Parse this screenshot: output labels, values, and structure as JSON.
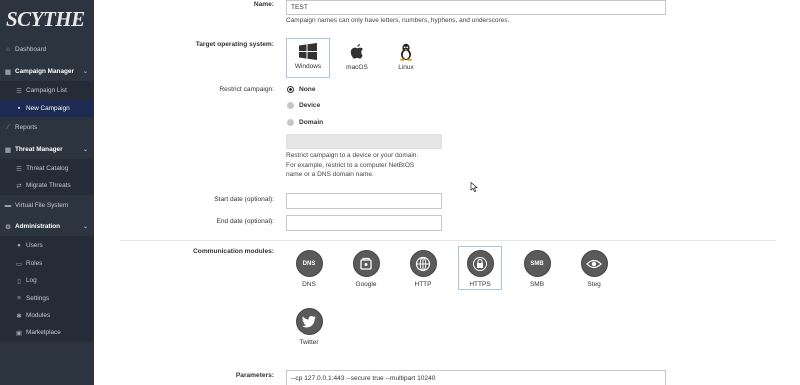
{
  "brand": {
    "logo_text": "SCYTHE"
  },
  "sidebar": {
    "dashboard": "Dashboard",
    "campaign_manager": "Campaign Manager",
    "campaign_list": "Campaign List",
    "new_campaign": "New Campaign",
    "reports": "Reports",
    "threat_manager": "Threat Manager",
    "threat_catalog": "Threat Catalog",
    "migrate_threats": "Migrate Threats",
    "virtual_file_system": "Virtual File System",
    "administration": "Administration",
    "users": "Users",
    "roles": "Roles",
    "log": "Log",
    "settings": "Settings",
    "modules": "Modules",
    "marketplace": "Marketplace"
  },
  "form": {
    "name_label": "Name:",
    "name_value": "TEST",
    "name_help": "Campaign names can only have letters, numbers, hyphens, and underscores.",
    "os_label": "Target operating system:",
    "os_options": [
      "Windows",
      "macOS",
      "Linux"
    ],
    "os_selected": "Windows",
    "restrict_label": "Restrict campaign:",
    "restrict_options": [
      "None",
      "Device",
      "Domain"
    ],
    "restrict_selected": "None",
    "restrict_value": "",
    "restrict_help": [
      "Restrict campaign to a device or your domain.",
      "For example, restrict to a computer NetBIOS",
      "name or a DNS domain name."
    ],
    "start_date_label": "Start date (optional):",
    "start_date_value": "",
    "end_date_label": "End date (optional):",
    "end_date_value": "",
    "modules_label": "Communication modules:",
    "modules": [
      "DNS",
      "Google",
      "HTTP",
      "HTTPS",
      "SMB",
      "Steg",
      "Twitter"
    ],
    "modules_selected": "HTTPS",
    "module_icon_text": {
      "dns": "DNS",
      "smb": "SMB"
    },
    "params_label": "Parameters:",
    "params_value": "--cp 127.0.0.1:443 --secure true --multipart 10240"
  }
}
